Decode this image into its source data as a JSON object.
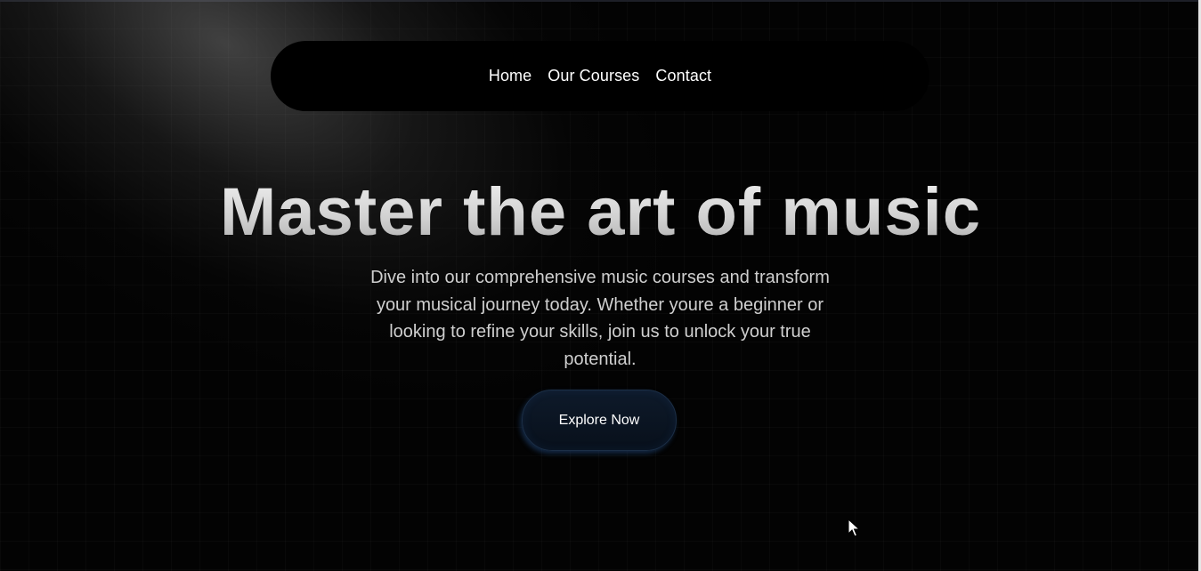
{
  "nav": {
    "items": [
      {
        "label": "Home"
      },
      {
        "label": "Our Courses"
      },
      {
        "label": "Contact"
      }
    ]
  },
  "hero": {
    "title": "Master the art of music",
    "subtitle": "Dive into our comprehensive music courses and transform your musical journey today. Whether youre a beginner or looking to refine your skills, join us to unlock your true potential.",
    "cta_label": "Explore Now"
  },
  "colors": {
    "background": "#030303",
    "accent_button": "#0e1a2a",
    "accent_glow": "#326ebe",
    "text": "#ffffff",
    "subtitle_text": "#cfcfcf"
  },
  "icons": {
    "cursor": "mouse-pointer-icon"
  }
}
